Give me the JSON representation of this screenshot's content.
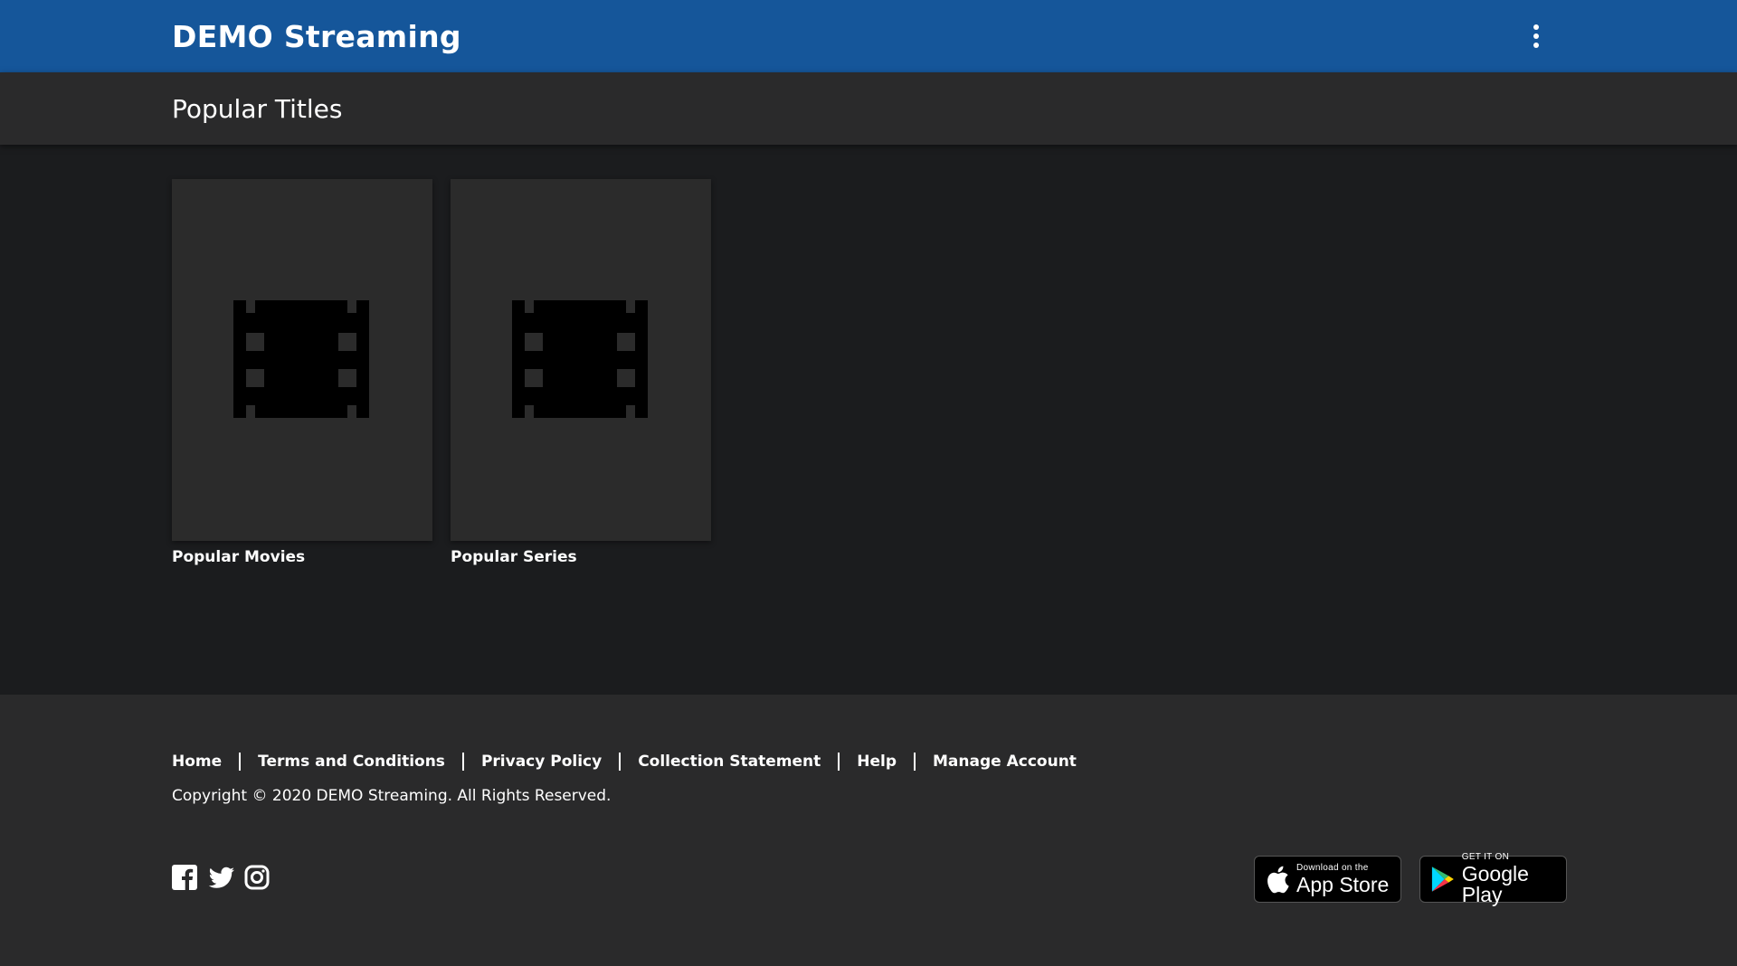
{
  "header": {
    "brand": "DEMO Streaming",
    "menu_icon": "more-vertical-icon"
  },
  "subheader": {
    "title": "Popular Titles"
  },
  "tiles": [
    {
      "label": "Popular Movies",
      "icon": "film-icon"
    },
    {
      "label": "Popular Series",
      "icon": "film-icon"
    }
  ],
  "footer": {
    "links": [
      "Home",
      "Terms and Conditions",
      "Privacy Policy",
      "Collection Statement",
      "Help",
      "Manage Account"
    ],
    "copyright": "Copyright © 2020 DEMO Streaming. All Rights Reserved.",
    "social": [
      "facebook-icon",
      "twitter-icon",
      "instagram-icon"
    ],
    "stores": {
      "apple": {
        "small": "Download on the",
        "big": "App Store"
      },
      "google": {
        "small": "GET IT ON",
        "big": "Google Play"
      }
    }
  },
  "colors": {
    "header_bg": "#15569a",
    "subheader_bg": "#2a2a2b",
    "body_bg": "#1b1c1e",
    "tile_bg": "#2b2b2b"
  }
}
